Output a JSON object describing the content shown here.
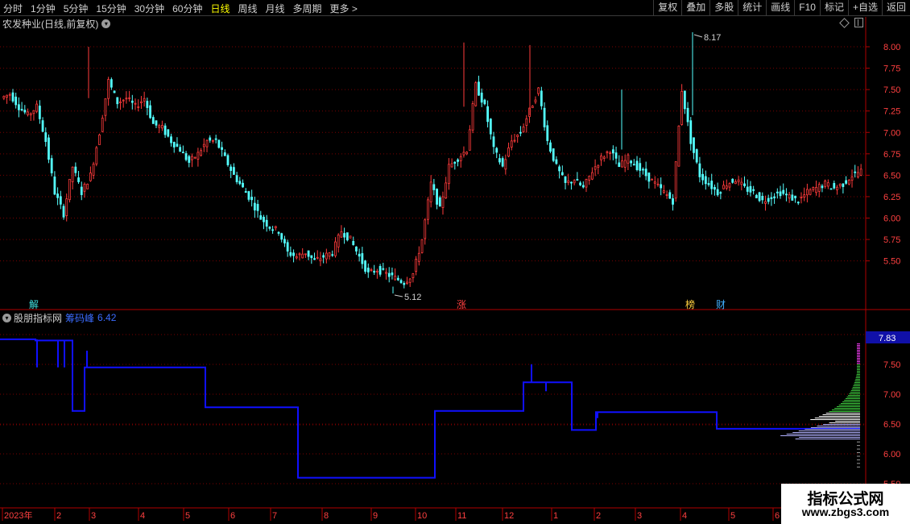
{
  "toolbar": {
    "periods": [
      {
        "label": "分时",
        "active": false
      },
      {
        "label": "1分钟",
        "active": false
      },
      {
        "label": "5分钟",
        "active": false
      },
      {
        "label": "15分钟",
        "active": false
      },
      {
        "label": "30分钟",
        "active": false
      },
      {
        "label": "60分钟",
        "active": false
      },
      {
        "label": "日线",
        "active": true
      },
      {
        "label": "周线",
        "active": false
      },
      {
        "label": "月线",
        "active": false
      },
      {
        "label": "多周期",
        "active": false
      },
      {
        "label": "更多 >",
        "active": false
      }
    ],
    "actions": [
      "复权",
      "叠加",
      "多股",
      "统计",
      "画线",
      "F10",
      "标记",
      "+自选",
      "返回"
    ]
  },
  "main_chart": {
    "title": "农发种业(日线,前复权)",
    "high_label": "8.17",
    "low_label": "5.12",
    "markers": [
      {
        "label": "解",
        "color": "#40e0e0"
      },
      {
        "label": "涨",
        "color": "#ff4040"
      },
      {
        "label": "榜",
        "color": "#ffd040"
      },
      {
        "label": "财",
        "color": "#40b0ff"
      }
    ],
    "y_ticks": [
      "8.00",
      "7.75",
      "7.50",
      "7.25",
      "7.00",
      "6.75",
      "6.50",
      "6.25",
      "6.00",
      "5.75",
      "5.50"
    ]
  },
  "indicator": {
    "name": "股朋指标网",
    "series_label": "筹码峰",
    "series_value": "6.42",
    "current_price_label": "7.83",
    "y_ticks": [
      "7.50",
      "7.00",
      "6.50",
      "6.00",
      "5.50"
    ]
  },
  "x_axis": {
    "labels": [
      "2023年",
      "2",
      "3",
      "4",
      "5",
      "6",
      "7",
      "8",
      "9",
      "10",
      "11",
      "12",
      "1",
      "2",
      "3",
      "4",
      "5",
      "6"
    ]
  },
  "colors": {
    "up": "#ff3b3b",
    "down": "#54ffff",
    "indicator_line": "#1010ff",
    "grid": "#7a0000",
    "axis_text": "#ff4040"
  },
  "watermark": {
    "line1": "指标公式网",
    "line2": "www.zbgs3.com"
  },
  "chart_data": {
    "type": "candlestick",
    "title": "农发种业(日线,前复权)",
    "x_month_labels": [
      "2023年",
      "2",
      "3",
      "4",
      "5",
      "6",
      "7",
      "8",
      "9",
      "10",
      "11",
      "12",
      "1",
      "2",
      "3",
      "4",
      "5",
      "6"
    ],
    "price_ylim": [
      5.3,
      8.2
    ],
    "close_path_approx": [
      7.45,
      7.3,
      7.2,
      7.3,
      6.9,
      6.3,
      6.05,
      6.6,
      6.3,
      6.5,
      7.0,
      7.6,
      7.35,
      7.4,
      7.3,
      7.4,
      7.1,
      7.05,
      6.9,
      6.8,
      6.65,
      6.75,
      6.9,
      6.9,
      6.7,
      6.5,
      6.35,
      6.2,
      6.0,
      5.9,
      5.85,
      5.6,
      5.55,
      5.6,
      5.5,
      5.55,
      5.6,
      5.85,
      5.75,
      5.55,
      5.35,
      5.4,
      5.35,
      5.3,
      5.25,
      5.35,
      5.75,
      6.4,
      6.1,
      6.6,
      6.7,
      6.8,
      7.55,
      7.3,
      6.8,
      6.6,
      6.9,
      7.0,
      7.25,
      7.5,
      6.9,
      6.6,
      6.4,
      6.45,
      6.35,
      6.55,
      6.7,
      6.8,
      6.6,
      6.7,
      6.6,
      6.5,
      6.4,
      6.3,
      6.2,
      7.5,
      6.9,
      6.5,
      6.4,
      6.3,
      6.4,
      6.45,
      6.35,
      6.3,
      6.2,
      6.25,
      6.3,
      6.25,
      6.2,
      6.3,
      6.35,
      6.4,
      6.35,
      6.4,
      6.5,
      6.55
    ],
    "extremes": {
      "high": 8.17,
      "low": 5.12
    },
    "indicator_series": {
      "name": "筹码峰",
      "last_value": 6.42,
      "steps": [
        {
          "from": 0,
          "to": 44,
          "value": 7.92
        },
        {
          "from": 44,
          "to": 90,
          "value": 7.9
        },
        {
          "from": 90,
          "to": 105,
          "value": 6.72
        },
        {
          "from": 105,
          "to": 255,
          "value": 7.45
        },
        {
          "from": 255,
          "to": 370,
          "value": 6.78
        },
        {
          "from": 370,
          "to": 540,
          "value": 5.6
        },
        {
          "from": 540,
          "to": 650,
          "value": 6.72
        },
        {
          "from": 650,
          "to": 710,
          "value": 7.2
        },
        {
          "from": 710,
          "to": 740,
          "value": 6.4
        },
        {
          "from": 740,
          "to": 890,
          "value": 6.7
        },
        {
          "from": 890,
          "to": 1068,
          "value": 6.42
        }
      ],
      "ylim": [
        5.5,
        7.83
      ]
    }
  }
}
